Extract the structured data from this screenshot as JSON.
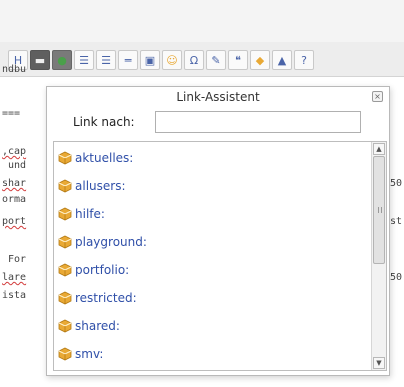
{
  "toolbar": {
    "buttons": [
      {
        "name": "heading-icon",
        "glyph": "H"
      },
      {
        "name": "link-icon",
        "glyph": "▬"
      },
      {
        "name": "external-link-icon",
        "glyph": "●"
      },
      {
        "name": "ordered-list-icon",
        "glyph": "☰"
      },
      {
        "name": "unordered-list-icon",
        "glyph": "☰"
      },
      {
        "name": "horizontal-rule-icon",
        "glyph": "═"
      },
      {
        "name": "image-icon",
        "glyph": "▣"
      },
      {
        "name": "smiley-icon",
        "glyph": "☺"
      },
      {
        "name": "special-chars-icon",
        "glyph": "Ω"
      },
      {
        "name": "signature-icon",
        "glyph": "✎"
      },
      {
        "name": "quote-icon",
        "glyph": "❝"
      },
      {
        "name": "insert-link-icon",
        "glyph": "◆"
      },
      {
        "name": "media-icon",
        "glyph": "▲"
      },
      {
        "name": "more-icon",
        "glyph": "?"
      }
    ]
  },
  "editor": {
    "lines": [
      {
        "text": "ndbu",
        "right": ""
      },
      {
        "text": "===",
        "right": ""
      },
      {
        "text": ",cap",
        "right": ""
      },
      {
        "text": " und",
        "right": ""
      },
      {
        "text": "shar",
        "right": "50"
      },
      {
        "text": "orma",
        "right": ""
      },
      {
        "text": "port",
        "right": "st"
      },
      {
        "text": " For",
        "right": ""
      },
      {
        "text": "lare",
        "right": "50"
      },
      {
        "text": "ista",
        "right": ""
      }
    ]
  },
  "dialog": {
    "title": "Link-Assistent",
    "close_label": "×",
    "link_label": "Link nach:",
    "link_value": "",
    "items": [
      "aktuelles:",
      "allusers:",
      "hilfe:",
      "playground:",
      "portfolio:",
      "restricted:",
      "shared:",
      "smv:"
    ]
  },
  "colors": {
    "link": "#2f4fa8",
    "namespace_icon": "#e9a935",
    "toolbar_bg": "#ededed"
  }
}
